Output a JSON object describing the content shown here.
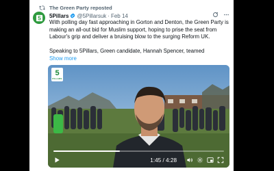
{
  "post": {
    "repost_label": "The Green Party reposted",
    "author_name": "5Pillars",
    "handle": "@5Pillarsuk",
    "separator": "·",
    "date": "Feb 14",
    "body_p1": "With polling day fast approaching in Gorton and Denton, the Green Party is making an all-out bid for Muslim support, hoping to prise the seat from Labour's grip and deliver a bruising blow to the surging Reform UK.",
    "body_p2": "Speaking to 5Pillars, Green candidate, Hannah Spencer, teamed",
    "show_more": "Show more"
  },
  "video": {
    "logo_number": "5",
    "logo_word": "PILLARS",
    "current_time": "1:45",
    "duration": "4:28",
    "time_display": "1:45 / 4:28",
    "progress_fraction": 0.39,
    "controls": [
      "play-icon",
      "volume-icon",
      "settings-icon",
      "pip-icon",
      "fullscreen-icon"
    ]
  },
  "colors": {
    "link": "#1d9bf0",
    "avatar_bg": "#2e9a3e",
    "verified": "#1d9bf0",
    "muted_text": "#536471"
  }
}
